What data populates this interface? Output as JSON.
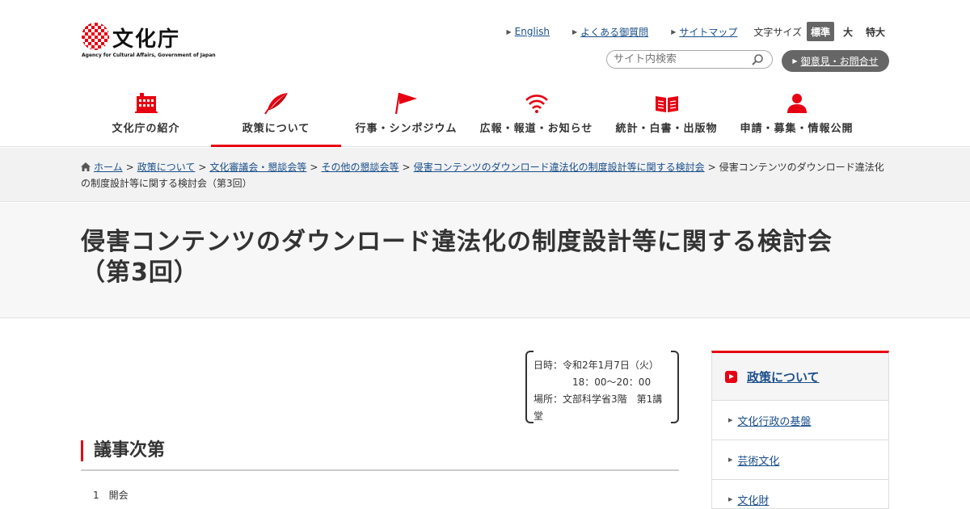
{
  "logo": {
    "name": "文化庁",
    "sub": "Agency for Cultural Affairs, Government of Japan"
  },
  "util_links": [
    "English",
    "よくある御質問",
    "サイトマップ"
  ],
  "font_size": {
    "label": "文字サイズ",
    "options": [
      "標準",
      "大",
      "特大"
    ],
    "selected": "標準"
  },
  "search": {
    "placeholder": "サイト内検索"
  },
  "contact": {
    "label": "御意見・お問合せ"
  },
  "nav": [
    {
      "label": "文化庁の紹介",
      "icon": "building-icon"
    },
    {
      "label": "政策について",
      "icon": "quill-icon",
      "active": true
    },
    {
      "label": "行事・シンポジウム",
      "icon": "flag-icon"
    },
    {
      "label": "広報・報道・お知らせ",
      "icon": "wifi-icon"
    },
    {
      "label": "統計・白書・出版物",
      "icon": "book-icon"
    },
    {
      "label": "申請・募集・情報公開",
      "icon": "person-icon"
    }
  ],
  "breadcrumb": {
    "links": [
      "ホーム",
      "政策について",
      "文化審議会・懇談会等",
      "その他の懇談会等",
      "侵害コンテンツのダウンロード違法化の制度設計等に関する検討会"
    ],
    "current": "侵害コンテンツのダウンロード違法化の制度設計等に関する検討会（第3回）"
  },
  "page_title": "侵害コンテンツのダウンロード違法化の制度設計等に関する検討会（第3回）",
  "meeting": {
    "date": "日時：令和2年1月7日（火）",
    "time": "18：00～20：00",
    "place": "場所：文部科学省3階　第1講堂"
  },
  "agenda": {
    "heading": "議事次第",
    "items": [
      "1　開会"
    ]
  },
  "sidebar": {
    "heading": "政策について",
    "items": [
      "文化行政の基盤",
      "芸術文化",
      "文化財"
    ]
  },
  "colors": {
    "accent": "#e60012",
    "link": "#1a4f8b",
    "button_gray": "#666666"
  }
}
